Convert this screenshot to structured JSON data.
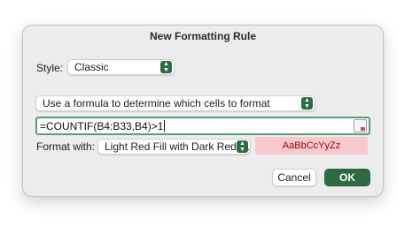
{
  "dialog": {
    "title": "New Formatting Rule",
    "style_label": "Style:",
    "style_value": "Classic",
    "rule_type": "Use a formula to determine which cells to format",
    "formula": "=COUNTIF(B4:B33,B4)>1",
    "format_label": "Format with:",
    "format_value": "Light Red Fill with Dark Red T...",
    "preview_text": "AaBbCcYyZz",
    "cancel_label": "Cancel",
    "ok_label": "OK"
  },
  "colors": {
    "accent": "#2e6b43",
    "preview_fill": "#f7c9ce",
    "preview_text": "#9c0006",
    "formula_border": "#5b9d70"
  },
  "icons": {
    "stepper": "updown-chevron-icon",
    "range_picker": "range-selector-icon"
  }
}
